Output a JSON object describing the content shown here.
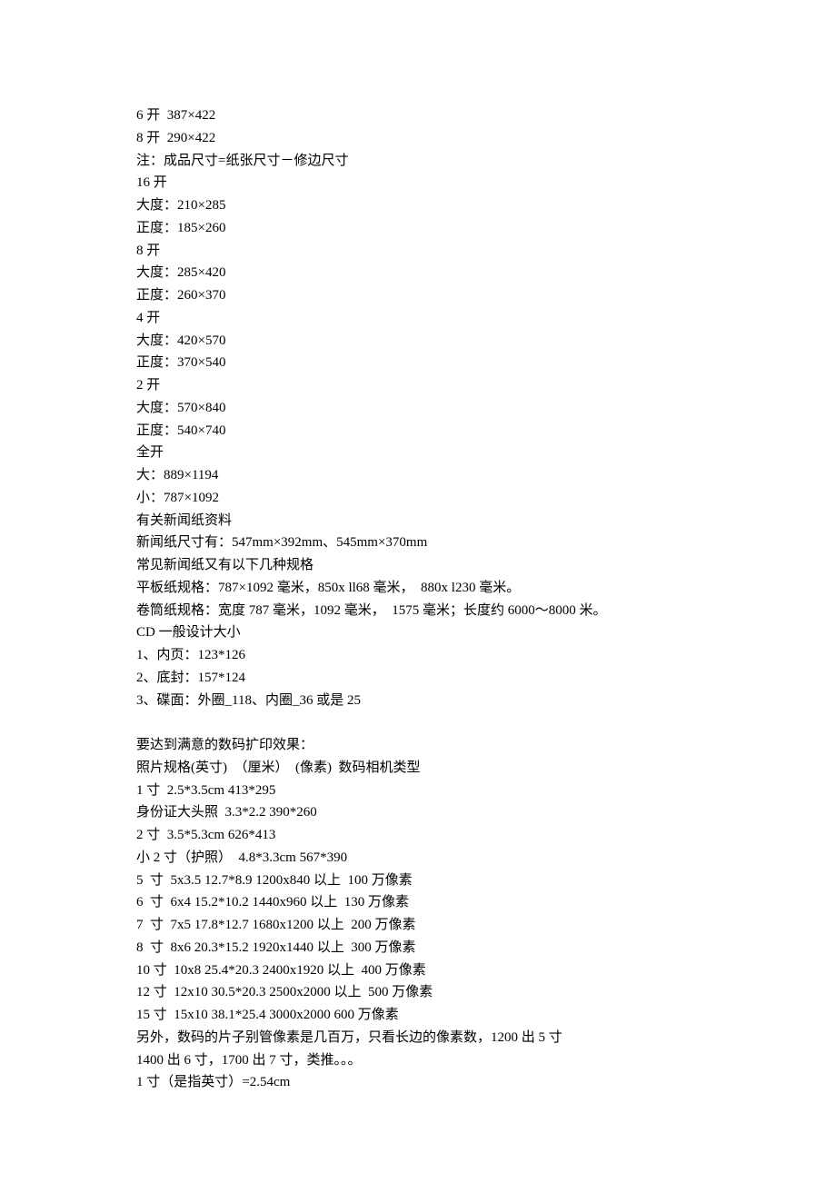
{
  "lines": [
    "6 开  387×422",
    "8 开  290×422",
    "注：成品尺寸=纸张尺寸－修边尺寸",
    "16 开",
    "大度：210×285",
    "正度：185×260",
    "8 开",
    "大度：285×420",
    "正度：260×370",
    "4 开",
    "大度：420×570",
    "正度：370×540",
    "2 开",
    "大度：570×840",
    "正度：540×740",
    "全开",
    "大：889×1194",
    "小：787×1092",
    "有关新闻纸资料",
    "新闻纸尺寸有：547mm×392mm、545mm×370mm",
    "常见新闻纸又有以下几种规格",
    "平板纸规格：787×1092 毫米，850x ll68 毫米，  880x l230 毫米。",
    "卷筒纸规格：宽度 787 毫米，1092 毫米，  1575 毫米；长度约 6000～8000 米。",
    "CD 一般设计大小",
    "1、内页：123*126",
    "2、底封：157*124",
    "3、碟面：外圈_118、内圈_36 或是 25",
    "",
    "要达到满意的数码扩印效果：",
    "照片规格(英寸)  （厘米）  (像素)  数码相机类型",
    "1 寸  2.5*3.5cm 413*295",
    "身份证大头照  3.3*2.2 390*260",
    "2 寸  3.5*5.3cm 626*413",
    "小 2 寸（护照）  4.8*3.3cm 567*390",
    "5  寸  5x3.5 12.7*8.9 1200x840 以上  100 万像素",
    "6  寸  6x4 15.2*10.2 1440x960 以上  130 万像素",
    "7  寸  7x5 17.8*12.7 1680x1200 以上  200 万像素",
    "8  寸  8x6 20.3*15.2 1920x1440 以上  300 万像素",
    "10 寸  10x8 25.4*20.3 2400x1920 以上  400 万像素",
    "12 寸  12x10 30.5*20.3 2500x2000 以上  500 万像素",
    "15 寸  15x10 38.1*25.4 3000x2000 600 万像素",
    "另外，数码的片子别管像素是几百万，只看长边的像素数，1200 出 5 寸",
    "1400 出 6 寸，1700 出 7 寸，类推。。。",
    "1 寸（是指英寸）=2.54cm"
  ]
}
